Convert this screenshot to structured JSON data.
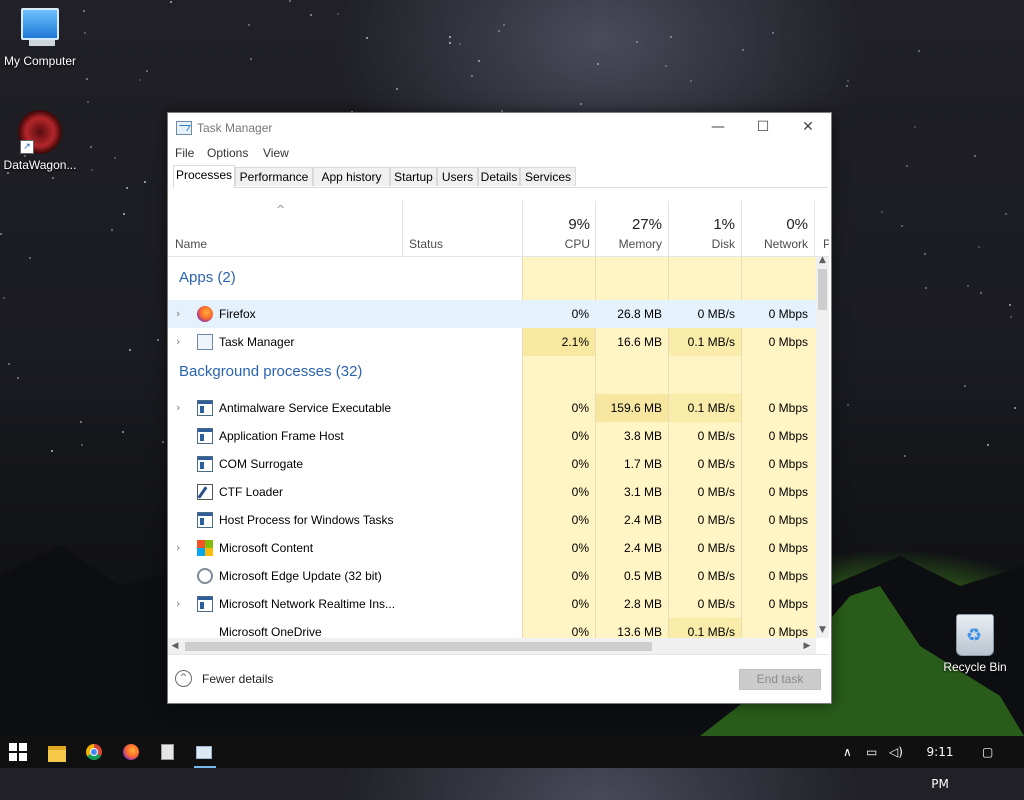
{
  "desktop": {
    "icons": [
      {
        "label": "My Computer"
      },
      {
        "label": "DataWagon..."
      },
      {
        "label": "Recycle Bin"
      }
    ]
  },
  "window": {
    "title": "Task Manager",
    "controls": {
      "minimize": "—",
      "maximize": "☐",
      "close": "✕"
    },
    "menu": [
      "File",
      "Options",
      "View"
    ],
    "tabs": [
      "Processes",
      "Performance",
      "App history",
      "Startup",
      "Users",
      "Details",
      "Services"
    ],
    "active_tab": "Processes",
    "columns": {
      "name": "Name",
      "status": "Status",
      "cpu": {
        "pct": "9%",
        "label": "CPU"
      },
      "memory": {
        "pct": "27%",
        "label": "Memory"
      },
      "disk": {
        "pct": "1%",
        "label": "Disk"
      },
      "network": {
        "pct": "0%",
        "label": "Network"
      },
      "power_partial": "P"
    },
    "groups": {
      "apps": "Apps (2)",
      "background": "Background processes (32)"
    },
    "apps": [
      {
        "name": "Firefox",
        "cpu": "0%",
        "memory": "26.8 MB",
        "disk": "0 MB/s",
        "network": "0 Mbps",
        "icon": "firefox-icon",
        "expandable": true
      },
      {
        "name": "Task Manager",
        "cpu": "2.1%",
        "memory": "16.6 MB",
        "disk": "0.1 MB/s",
        "network": "0 Mbps",
        "icon": "task-manager-icon",
        "expandable": true
      }
    ],
    "background": [
      {
        "name": "Antimalware Service Executable",
        "cpu": "0%",
        "memory": "159.6 MB",
        "disk": "0.1 MB/s",
        "network": "0 Mbps",
        "icon": "window-process-icon",
        "expandable": true
      },
      {
        "name": "Application Frame Host",
        "cpu": "0%",
        "memory": "3.8 MB",
        "disk": "0 MB/s",
        "network": "0 Mbps",
        "icon": "window-process-icon",
        "expandable": false
      },
      {
        "name": "COM Surrogate",
        "cpu": "0%",
        "memory": "1.7 MB",
        "disk": "0 MB/s",
        "network": "0 Mbps",
        "icon": "window-process-icon",
        "expandable": false
      },
      {
        "name": "CTF Loader",
        "cpu": "0%",
        "memory": "3.1 MB",
        "disk": "0 MB/s",
        "network": "0 Mbps",
        "icon": "ctf-loader-icon",
        "expandable": false
      },
      {
        "name": "Host Process for Windows Tasks",
        "cpu": "0%",
        "memory": "2.4 MB",
        "disk": "0 MB/s",
        "network": "0 Mbps",
        "icon": "window-process-icon",
        "expandable": false
      },
      {
        "name": "Microsoft Content",
        "cpu": "0%",
        "memory": "2.4 MB",
        "disk": "0 MB/s",
        "network": "0 Mbps",
        "icon": "microsoft-logo-icon",
        "expandable": true
      },
      {
        "name": "Microsoft Edge Update (32 bit)",
        "cpu": "0%",
        "memory": "0.5 MB",
        "disk": "0 MB/s",
        "network": "0 Mbps",
        "icon": "edge-update-icon",
        "expandable": false
      },
      {
        "name": "Microsoft Network Realtime Ins...",
        "cpu": "0%",
        "memory": "2.8 MB",
        "disk": "0 MB/s",
        "network": "0 Mbps",
        "icon": "window-process-icon",
        "expandable": true
      },
      {
        "name": "Microsoft OneDrive",
        "cpu": "0%",
        "memory": "13.6 MB",
        "disk": "0.1 MB/s",
        "network": "0 Mbps",
        "icon": "none",
        "expandable": false
      }
    ],
    "footer": {
      "fewer_details": "Fewer details",
      "end_task": "End task"
    }
  },
  "taskbar": {
    "pinned": [
      "start-icon",
      "file-explorer-icon",
      "chrome-icon",
      "firefox-icon",
      "notepad-icon",
      "task-manager-icon"
    ],
    "clock": "9:11 PM",
    "tray_icons": [
      "chevron-up-icon",
      "network-icon",
      "volume-icon",
      "notification-icon"
    ]
  },
  "colors": {
    "heat_low": "#fff4c4",
    "heat_mid": "#f9eca8",
    "heat_cpu_high": "#f7e39a",
    "selected_row": "#e5f1fb",
    "group_text": "#2b64b0"
  }
}
